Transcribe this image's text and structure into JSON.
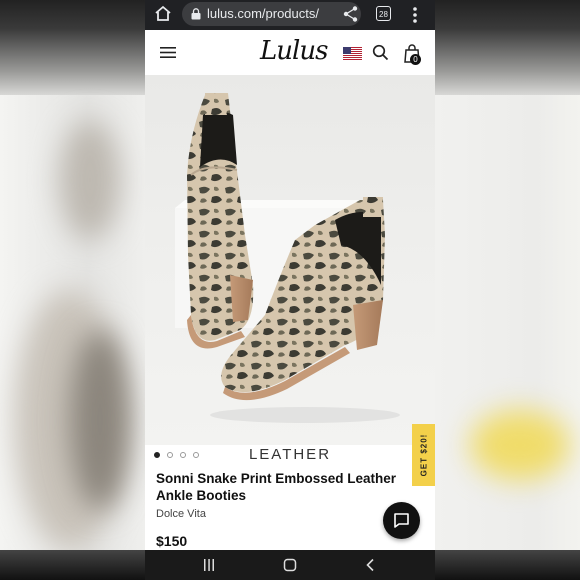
{
  "browser": {
    "url": "lulus.com/products/",
    "tab_count": "28"
  },
  "header": {
    "logo_text": "Lulus",
    "cart_count": "0"
  },
  "product": {
    "image_alt": "Snake print ankle booties",
    "material_label": "LEATHER",
    "name": "Sonni Snake Print Embossed Leather Ankle Booties",
    "brand": "Dolce Vita",
    "price": "$150",
    "carousel_dots": 4,
    "carousel_active": 0
  },
  "promo": {
    "label": "GET $20!"
  },
  "icons": {
    "home": "home-icon",
    "lock": "lock-icon",
    "share": "share-icon",
    "menu": "more-vert-icon",
    "hamburger": "hamburger-icon",
    "flag": "us-flag-icon",
    "search": "search-icon",
    "bag": "shopping-bag-icon",
    "chat": "chat-icon"
  },
  "colors": {
    "promo": "#f3d04a",
    "browser_bar": "#202124"
  }
}
